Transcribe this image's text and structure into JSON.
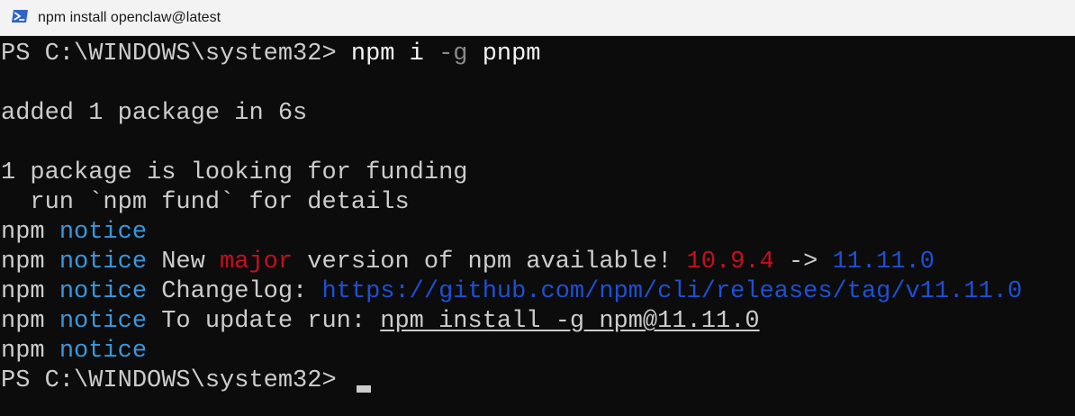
{
  "window": {
    "title": "npm install openclaw@latest",
    "icon": "powershell-icon"
  },
  "terminal": {
    "colors": {
      "background": "#0c0c0c",
      "text": "#cccccc",
      "notice": "#3a96dd",
      "major": "#c50f1f",
      "new_version": "#1e4fd6",
      "changelog_link": "#1e4fd6"
    },
    "line1": {
      "prompt": "PS C:\\WINDOWS\\system32> ",
      "cmd": "npm",
      "arg1": " i ",
      "flag": "-g",
      "arg2": " pnpm"
    },
    "line2": "added 1 package in 6s",
    "line3": "1 package is looking for funding",
    "line4": "  run `npm fund` for details",
    "notice_line1": {
      "prefix": "npm ",
      "notice": "notice"
    },
    "notice_line2": {
      "prefix": "npm ",
      "notice": "notice",
      "text1": " New ",
      "major": "major",
      "text2": " version of npm available! ",
      "old_version": "10.9.4",
      "arrow": " -> ",
      "new_version": "11.11.0"
    },
    "notice_line3": {
      "prefix": "npm ",
      "notice": "notice",
      "text": " Changelog: ",
      "link": "https://github.com/npm/cli/releases/tag/v11.11.0"
    },
    "notice_line4": {
      "prefix": "npm ",
      "notice": "notice",
      "text": " To update run: ",
      "command": "npm install -g npm@11.11.0"
    },
    "notice_line5": {
      "prefix": "npm ",
      "notice": "notice"
    },
    "final_prompt": "PS C:\\WINDOWS\\system32> "
  }
}
